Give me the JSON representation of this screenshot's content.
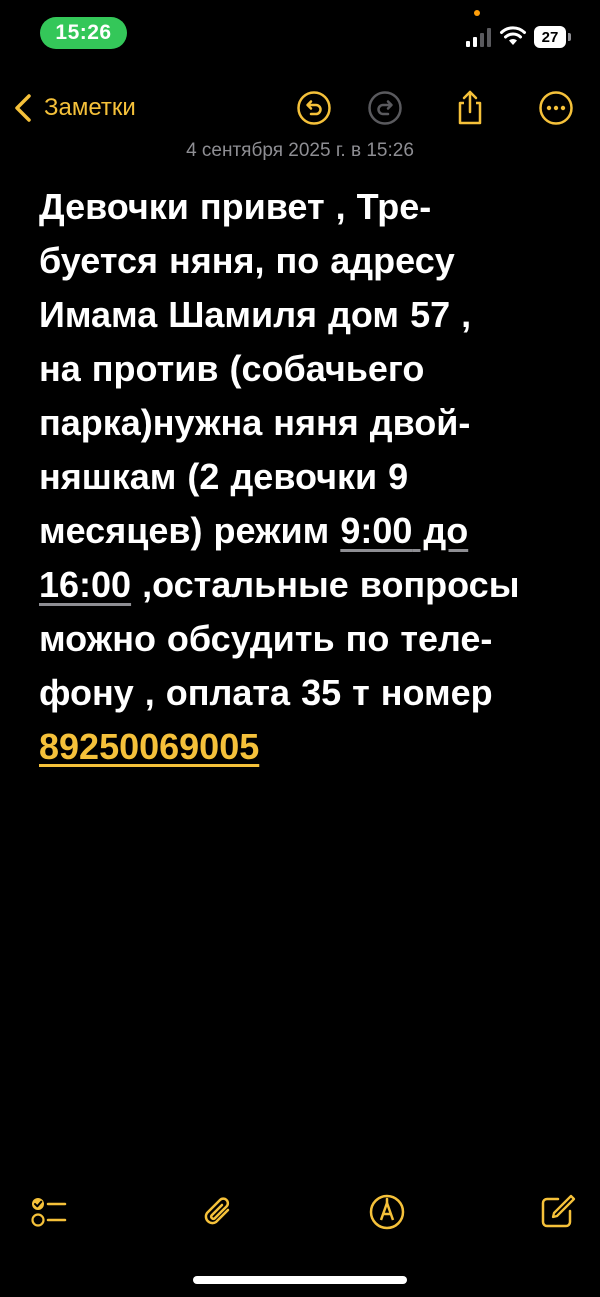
{
  "status_bar": {
    "time": "15:26",
    "battery": "27"
  },
  "nav": {
    "back_label": "Заметки"
  },
  "note": {
    "date": "4 сентября 2025 г. в 15:26",
    "lines": [
      "Девочки  привет  , Тре-",
      "буется няня, по адресу",
      "Имама Шамиля дом 57 ,",
      "на против (собачьего",
      "парка)нужна няня двой-",
      "няшкам (2 девочки 9"
    ],
    "line7_prefix": "месяцев) режим ",
    "time_from": "9:00",
    "time_mid": " до",
    "time_to": "16:00",
    "line8_suffix": " ,остальные вопросы",
    "line9": "можно обсудить по теле-",
    "line10": "фону , оплата 35 т номер",
    "phone": "89250069005"
  },
  "colors": {
    "accent": "#f5c13a",
    "background": "#000000",
    "time_pill": "#34c759",
    "secondary_text": "#8e8e93"
  },
  "icons": {
    "undo": "undo-icon",
    "redo": "redo-icon",
    "share": "share-icon",
    "more": "more-icon",
    "checklist": "checklist-icon",
    "attach": "paperclip-icon",
    "markup": "markup-pen-icon",
    "compose": "compose-icon"
  }
}
